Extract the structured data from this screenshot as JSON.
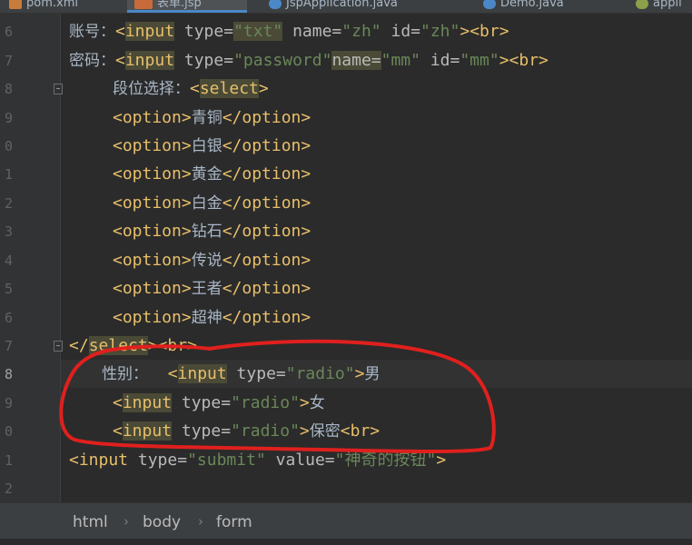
{
  "tabs": [
    {
      "label": "pom.xml",
      "icon_color": "#c77c3a",
      "active": false
    },
    {
      "label": "表单.jsp",
      "icon_color": "#c76b3a",
      "active": true
    },
    {
      "label": "JspApplication.java",
      "icon_color": "#4a88c7",
      "active": false
    },
    {
      "label": "Demo.java",
      "icon_color": "#4a88c7",
      "active": false
    },
    {
      "label": "appli",
      "icon_color": "#8aa04a",
      "active": false
    }
  ],
  "line_numbers": [
    "6",
    "7",
    "8",
    "9",
    "0",
    "1",
    "2",
    "3",
    "4",
    "5",
    "6",
    "7",
    "8",
    "9",
    "0",
    "1",
    "2"
  ],
  "current_line_index": 12,
  "code": {
    "l6": {
      "label": "账号：",
      "tag_open": "<",
      "tag": "input",
      "attr1": " type=",
      "val1": "\"txt\"",
      "attr2": " name=",
      "val2": "\"zh\"",
      "attr3": " id=",
      "val3": "\"zh\"",
      "close": "><br>"
    },
    "l7": {
      "label": "密码：",
      "tag_open": "<",
      "tag": "input",
      "attr1": " type=",
      "val1": "\"password\"",
      "attr2": "name=",
      "val2": "\"mm\"",
      "attr3": " id=",
      "val3": "\"mm\"",
      "close": "><br>"
    },
    "l8": {
      "label": "段位选择：",
      "tag_open": "<",
      "tag": "select",
      "close": ">"
    },
    "options": [
      "青铜",
      "白银",
      "黄金",
      "白金",
      "钻石",
      "传说",
      "王者",
      "超神"
    ],
    "option_open": "<option>",
    "option_close": "</option>",
    "l17": {
      "a": "</",
      "b": "select",
      "c": "><br>"
    },
    "l18": {
      "label": "性别：",
      "tag_open": "<",
      "tag": "input",
      "attr1": " type=",
      "val1": "\"radio\"",
      "close": ">",
      "text": "男"
    },
    "l19": {
      "tag_open": "<",
      "tag": "input",
      "attr1": " type=",
      "val1": "\"radio\"",
      "close": ">",
      "text": "女"
    },
    "l20": {
      "tag_open": "<",
      "tag": "input",
      "attr1": " type=",
      "val1": "\"radio\"",
      "close": ">",
      "text": "保密",
      "tail": "<br>"
    },
    "l21": {
      "tag_open": "<input",
      "attr1": " type=",
      "val1": "\"submit\"",
      "attr2": " value=",
      "val2": "\"神奇的按钮\"",
      "close": ">"
    }
  },
  "breadcrumb": [
    "html",
    "body",
    "form"
  ],
  "annotation_color": "#e0201e"
}
